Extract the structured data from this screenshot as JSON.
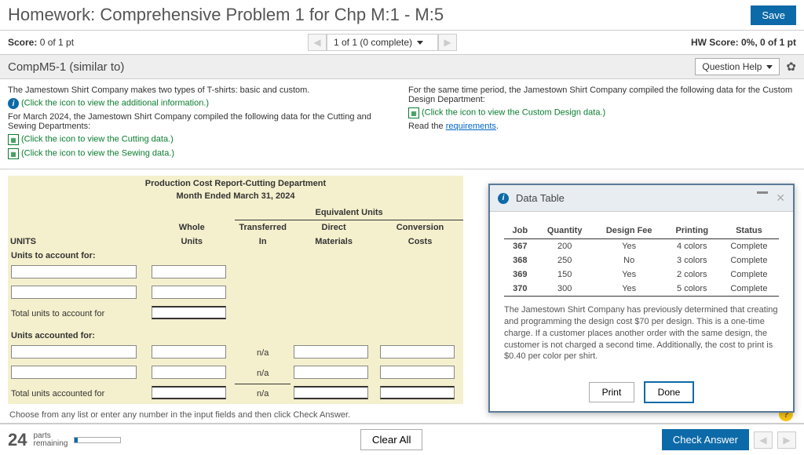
{
  "header": {
    "title": "Homework: Comprehensive Problem 1 for Chp M:1 - M:5",
    "save": "Save"
  },
  "subheader": {
    "score_label": "Score:",
    "score_value": "0 of 1 pt",
    "progress": "1 of 1 (0 complete)",
    "hw_label": "HW Score:",
    "hw_value": "0%, 0 of 1 pt"
  },
  "qrow": {
    "id": "CompM5-1 (similar to)",
    "help": "Question Help"
  },
  "problem": {
    "l1": "The Jamestown Shirt Company makes two types of T-shirts: basic and custom.",
    "l1a": "(Click the icon to view the additional information.)",
    "l2": "For March 2024, the Jamestown Shirt Company compiled the following data for the Cutting and Sewing Departments:",
    "l2a": "(Click the icon to view the Cutting data.)",
    "l2b": "(Click the icon to view the Sewing data.)",
    "r1": "For the same time period, the Jamestown Shirt Company compiled the following data for the Custom Design Department:",
    "r1a": "(Click the icon to view the Custom Design data.)",
    "r2a": "Read the ",
    "r2b": "requirements",
    "r2c": "."
  },
  "report": {
    "title": "Production Cost Report-Cutting Department",
    "subtitle": "Month Ended March 31, 2024",
    "eq": "Equivalent Units",
    "cols": {
      "whole1": "Whole",
      "whole2": "Units",
      "ti1": "Transferred",
      "ti2": "In",
      "dm1": "Direct",
      "dm2": "Materials",
      "cc1": "Conversion",
      "cc2": "Costs"
    },
    "units_label": "UNITS",
    "s1": "Units to account for:",
    "s1t": "Total units to account for",
    "s2": "Units accounted for:",
    "s2t": "Total units accounted for",
    "na": "n/a"
  },
  "instr": "Choose from any list or enter any number in the input fields and then click Check Answer.",
  "modal": {
    "title": "Data Table",
    "headers": [
      "Job",
      "Quantity",
      "Design Fee",
      "Printing",
      "Status"
    ],
    "rows": [
      [
        "367",
        "200",
        "Yes",
        "4 colors",
        "Complete"
      ],
      [
        "368",
        "250",
        "No",
        "3 colors",
        "Complete"
      ],
      [
        "369",
        "150",
        "Yes",
        "2 colors",
        "Complete"
      ],
      [
        "370",
        "300",
        "Yes",
        "5 colors",
        "Complete"
      ]
    ],
    "note": "The Jamestown Shirt Company has previously determined that creating and programming the design cost $70 per design. This is a one-time charge. If a customer places another order with the same design, the customer is not charged a second time. Additionally, the cost to print is $0.40 per color per shirt.",
    "print": "Print",
    "done": "Done"
  },
  "footer": {
    "count": "24",
    "p1": "parts",
    "p2": "remaining",
    "clear": "Clear All",
    "check": "Check Answer"
  }
}
